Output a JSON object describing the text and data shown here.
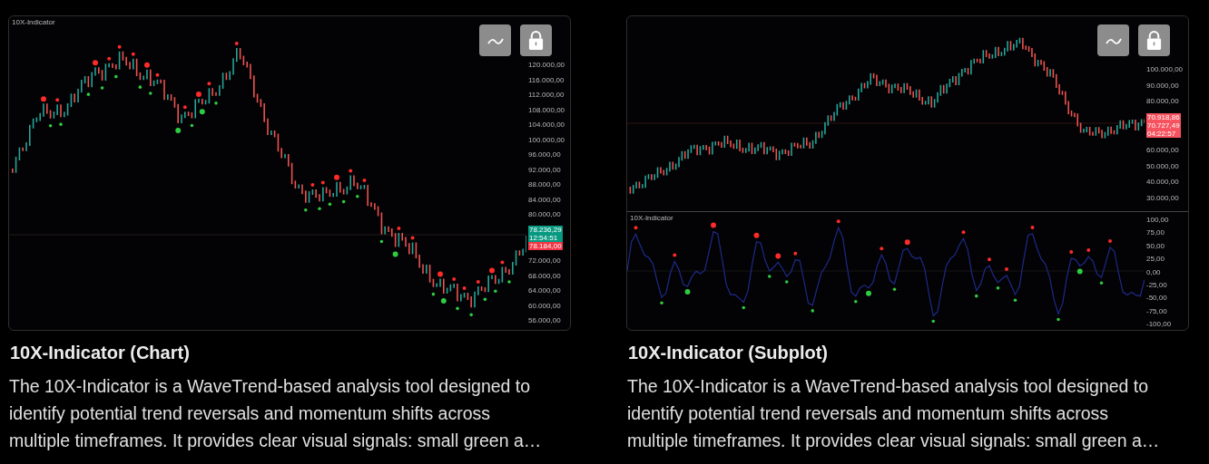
{
  "cards": [
    {
      "title": "10X-Indicator (Chart)",
      "description": "The 10X-Indicator is a WaveTrend-based analysis tool designed to identify potential trend reversals and momentum shifts across multiple timeframes. It provides clear visual signals: small green a…",
      "chart": {
        "kind": "overlay",
        "indicator_label": "10X-Indicator",
        "price_axis_upper": [
          "120.000,00",
          "116.000,00",
          "112.000,00",
          "108.000,00",
          "104.000,00",
          "100.000,00",
          "96.000,00",
          "92.000,00",
          "88.000,00",
          "84.000,00",
          "80.000,00"
        ],
        "price_badges": [
          {
            "text": "78.236,29",
            "color": "#089981"
          },
          {
            "text": "12:54:51",
            "color": "#089981"
          },
          {
            "text": "78.184,00",
            "color": "#f23645"
          }
        ],
        "price_axis_lower": [
          "72.000,00",
          "68.000,00",
          "64.000,00",
          "60.000,00",
          "56.000,00"
        ]
      }
    },
    {
      "title": "10X-Indicator (Subplot)",
      "description": "The 10X-Indicator is a WaveTrend-based analysis tool designed to identify potential trend reversals and momentum shifts across multiple timeframes. It provides clear visual signals: small green a…",
      "chart": {
        "kind": "subplot",
        "indicator_label": "10X-Indicator",
        "price_axis_upper": [
          "100.000,00",
          "90.000,00",
          "80.000,00"
        ],
        "price_badges": [
          {
            "text": "70.918,86",
            "color": "#f7525f"
          },
          {
            "text": "70.727,49",
            "color": "#f7525f"
          },
          {
            "text": "04:22:57",
            "color": "#f7525f"
          }
        ],
        "price_axis_lower": [
          "60.000,00",
          "50.000,00",
          "40.000,00",
          "30.000,00"
        ],
        "oscillator_axis": [
          "100,00",
          "75,00",
          "50,00",
          "25,00",
          "0,00",
          "-25,00",
          "-50,00",
          "-75,00",
          "-100,00"
        ]
      }
    }
  ]
}
